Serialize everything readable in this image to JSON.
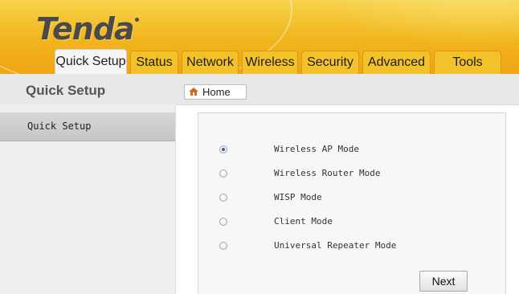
{
  "brand": {
    "logo_text": "Tenda",
    "accent": "#f1b51c"
  },
  "tabs": [
    {
      "label": "Quick Setup",
      "active": true
    },
    {
      "label": "Status"
    },
    {
      "label": "Network"
    },
    {
      "label": "Wireless"
    },
    {
      "label": "Security"
    },
    {
      "label": "Advanced"
    },
    {
      "label": "Tools"
    }
  ],
  "page": {
    "title": "Quick Setup",
    "home_label": "Home"
  },
  "sidebar": {
    "items": [
      {
        "label": "Quick Setup",
        "selected": true
      }
    ]
  },
  "modes": {
    "options": [
      {
        "label": "Wireless AP Mode",
        "checked": true
      },
      {
        "label": "Wireless Router Mode",
        "checked": false
      },
      {
        "label": "WISP Mode",
        "checked": false
      },
      {
        "label": "Client Mode",
        "checked": false
      },
      {
        "label": "Universal Repeater Mode",
        "checked": false
      }
    ]
  },
  "actions": {
    "next_label": "Next"
  }
}
